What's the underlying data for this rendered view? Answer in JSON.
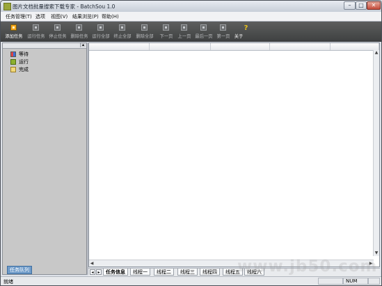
{
  "window": {
    "title": "图片文档批量搜索下载专家 - BatchSou 1.0",
    "minimize_glyph": "–",
    "maximize_glyph": "□",
    "close_glyph": "✕"
  },
  "menu": [
    "任务管理(T)",
    "选项",
    "视图(V)",
    "结果浏览(P)",
    "帮助(H)"
  ],
  "toolbar": [
    {
      "label": "添加任务",
      "icon": "add-task-icon",
      "enabled": true
    },
    {
      "label": "运行任务",
      "icon": "run-task-icon",
      "enabled": false
    },
    {
      "label": "停止任务",
      "icon": "stop-task-icon",
      "enabled": false
    },
    {
      "label": "删除任务",
      "icon": "delete-task-icon",
      "enabled": false
    },
    {
      "label": "运行全部",
      "icon": "run-all-icon",
      "enabled": false
    },
    {
      "label": "终止全部",
      "icon": "terminate-all-icon",
      "enabled": false
    },
    {
      "label": "删除全部",
      "icon": "delete-all-icon",
      "enabled": false
    },
    {
      "label": "下一页",
      "icon": "next-page-icon",
      "enabled": false
    },
    {
      "label": "上一页",
      "icon": "prev-page-icon",
      "enabled": false
    },
    {
      "label": "最后一页",
      "icon": "last-page-icon",
      "enabled": false
    },
    {
      "label": "第一页",
      "icon": "first-page-icon",
      "enabled": false
    },
    {
      "label": "关于",
      "icon": "help-icon",
      "enabled": true
    }
  ],
  "tree": [
    {
      "label": "等待",
      "icon": "wait-icon"
    },
    {
      "label": "运行",
      "icon": "run-icon"
    },
    {
      "label": "完成",
      "icon": "done-icon"
    }
  ],
  "left_tab": "任务队列",
  "sheet_tabs": [
    "任务信息",
    "线程一",
    "线程二",
    "线程三",
    "线程四",
    "线程五",
    "线程六"
  ],
  "status": {
    "text": "就绪",
    "num": "NUM"
  },
  "watermark": "www.jb50.com",
  "colors": {
    "accent": "#f5a61b",
    "toolbar_bg": "#4a4b4c"
  }
}
